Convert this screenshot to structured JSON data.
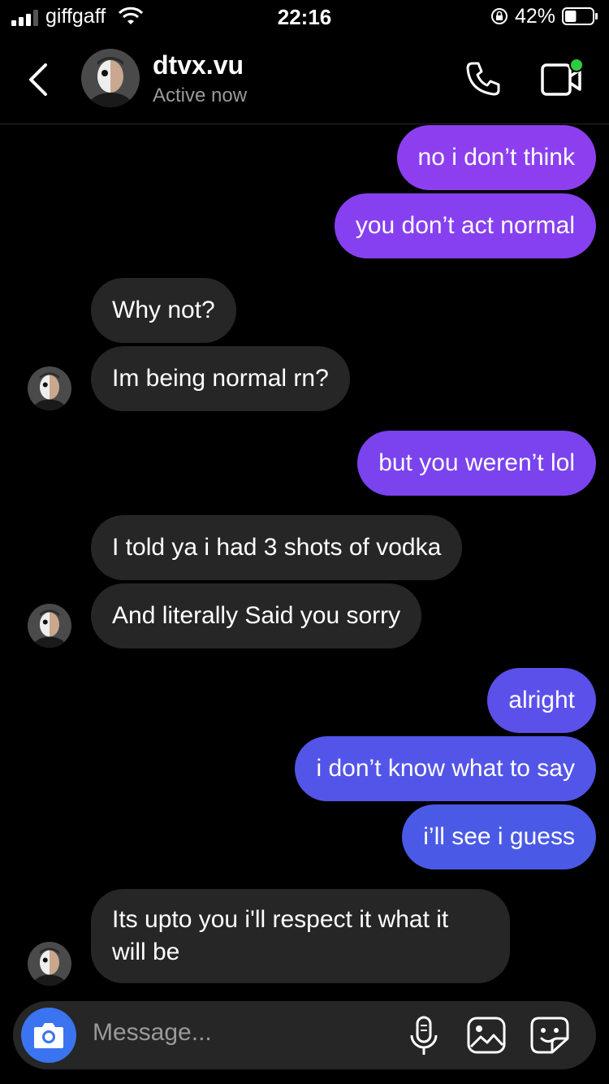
{
  "status_bar": {
    "carrier": "giffgaff",
    "time": "22:16",
    "battery_pct": "42%",
    "battery_level": 0.42,
    "icons": [
      "signal-icon",
      "wifi-icon",
      "orientation-lock-icon",
      "battery-icon"
    ]
  },
  "header": {
    "username": "dtvx.vu",
    "status": "Active now",
    "icons": [
      "back-chevron-icon",
      "phone-icon",
      "video-call-icon"
    ],
    "active_dot_color": "#2ecc40"
  },
  "messages": [
    {
      "from": "me",
      "text": "no i don’t think"
    },
    {
      "from": "me",
      "text": "you don’t act normal"
    },
    {
      "from": "them",
      "text": "Why not?"
    },
    {
      "from": "them",
      "text": "Im being normal rn?"
    },
    {
      "from": "me",
      "text": "but you weren’t lol"
    },
    {
      "from": "them",
      "text": "I told ya i had 3 shots of vodka"
    },
    {
      "from": "them",
      "text": "And literally Said you sorry"
    },
    {
      "from": "me",
      "text": "alright"
    },
    {
      "from": "me",
      "text": "i don’t know what to say"
    },
    {
      "from": "me",
      "text": "i’ll see i guess"
    },
    {
      "from": "them",
      "text": "Its upto you i'll respect it what it will be"
    }
  ],
  "composer": {
    "placeholder": "Message...",
    "icons": [
      "camera-icon",
      "microphone-icon",
      "gallery-icon",
      "sticker-icon"
    ]
  },
  "colors": {
    "outgoing_top": "#8f3ff0",
    "outgoing_mid": "#7444ee",
    "outgoing_bottom": "#4a5ae6",
    "incoming": "#262626",
    "camera_button": "#3a74f0"
  }
}
